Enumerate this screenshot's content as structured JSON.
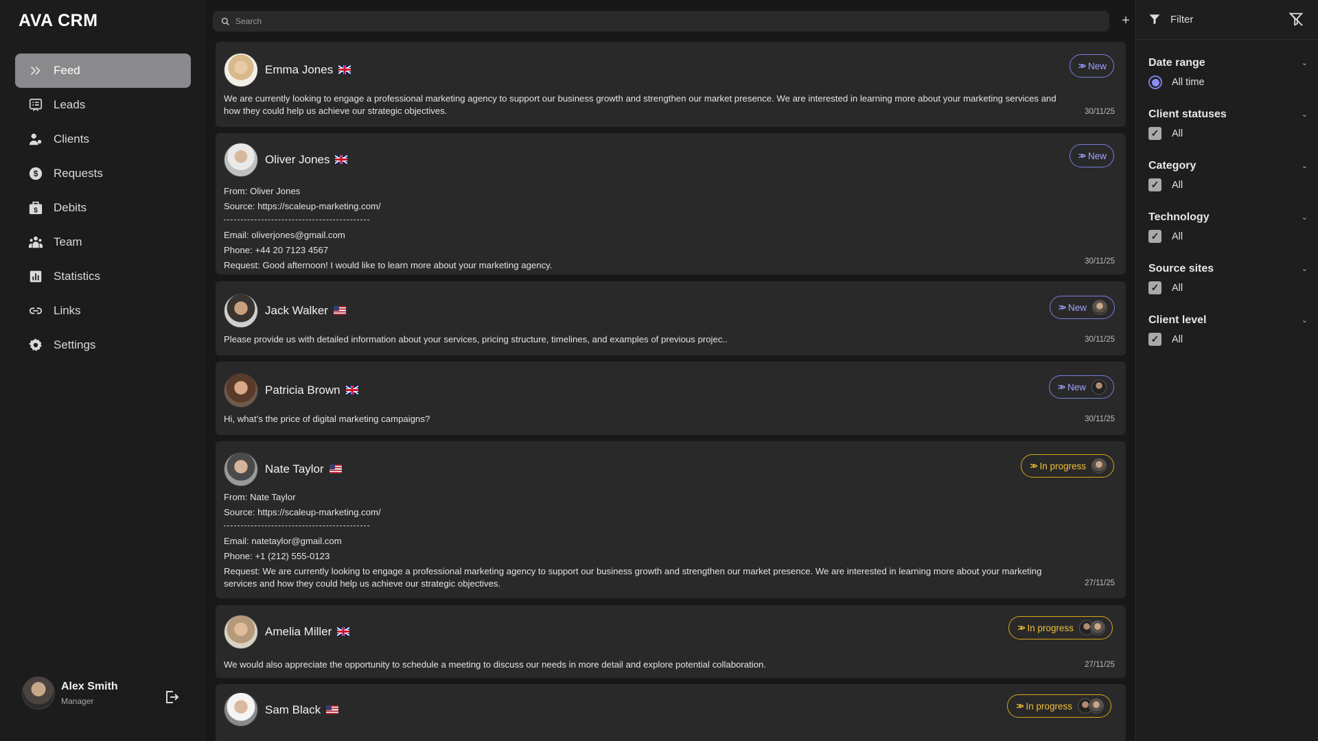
{
  "app": {
    "title": "AVA CRM"
  },
  "sidebar": {
    "items": [
      {
        "label": "Feed",
        "icon": "chevrons-right-icon",
        "active": true
      },
      {
        "label": "Leads",
        "icon": "leads-list-icon",
        "active": false
      },
      {
        "label": "Clients",
        "icon": "clients-icon",
        "active": false
      },
      {
        "label": "Requests",
        "icon": "dollar-circle-icon",
        "active": false
      },
      {
        "label": "Debits",
        "icon": "wallet-dollar-icon",
        "active": false
      },
      {
        "label": "Team",
        "icon": "team-icon",
        "active": false
      },
      {
        "label": "Statistics",
        "icon": "bar-chart-icon",
        "active": false
      },
      {
        "label": "Links",
        "icon": "link-icon",
        "active": false
      },
      {
        "label": "Settings",
        "icon": "gear-icon",
        "active": false
      }
    ],
    "user": {
      "name": "Alex Smith",
      "role": "Manager"
    }
  },
  "search": {
    "placeholder": "Search",
    "value": ""
  },
  "feed": {
    "cards": [
      {
        "name": "Emma Jones",
        "flag": "uk",
        "status": "New",
        "text": "We are currently looking to engage a professional marketing agency to support our business growth and strengthen our market presence. We are interested in learning more about your marketing services and how they could help us achieve our strategic objectives.",
        "date": "30/11/25"
      },
      {
        "name": "Oliver Jones",
        "flag": "uk",
        "status": "New",
        "from": "From: Oliver Jones",
        "source": "Source: https://scaleup-marketing.com/",
        "email": "Email: oliverjones@gmail.com",
        "phone": "Phone: +44 20 7123 4567",
        "request": "Request: Good afternoon! I would like to learn more about your marketing agency.",
        "date": "30/11/25"
      },
      {
        "name": "Jack Walker",
        "flag": "us",
        "status": "New",
        "text": "Please provide us with detailed information about your services, pricing structure, timelines, and examples of previous projec..",
        "date": "30/11/25"
      },
      {
        "name": "Patricia Brown",
        "flag": "uk",
        "status": "New",
        "text": "Hi, what’s the price of digital marketing campaigns?",
        "date": "30/11/25"
      },
      {
        "name": "Nate Taylor",
        "flag": "us",
        "status": "In progress",
        "from": "From: Nate Taylor",
        "source": "Source: https://scaleup-marketing.com/",
        "email": "Email: natetaylor@gmail.com",
        "phone": "Phone: +1 (212) 555-0123",
        "request": "Request: We are currently looking to engage a professional marketing agency to support our business growth and strengthen our market presence. We are interested in learning more about your marketing services and how they could help us achieve our strategic objectives.",
        "date": "27/11/25"
      },
      {
        "name": "Amelia Miller",
        "flag": "uk",
        "status": "In progress",
        "text": "We would also appreciate the opportunity to schedule a meeting to discuss our needs in more detail and explore potential collaboration.",
        "date": "27/11/25"
      },
      {
        "name": "Sam Black",
        "flag": "us",
        "status": "In progress",
        "text": "",
        "date": ""
      }
    ]
  },
  "filter": {
    "title": "Filter",
    "groups": [
      {
        "title": "Date range",
        "option": "All time",
        "type": "radio"
      },
      {
        "title": "Client statuses",
        "option": "All",
        "type": "checkbox"
      },
      {
        "title": "Category",
        "option": "All",
        "type": "checkbox"
      },
      {
        "title": "Technology",
        "option": "All",
        "type": "checkbox"
      },
      {
        "title": "Source sites",
        "option": "All",
        "type": "checkbox"
      },
      {
        "title": "Client level",
        "option": "All",
        "type": "checkbox"
      }
    ]
  },
  "colors": {
    "new": "#7b7fe0",
    "in_progress": "#d9a916",
    "active_nav": "#8a8a8d"
  }
}
